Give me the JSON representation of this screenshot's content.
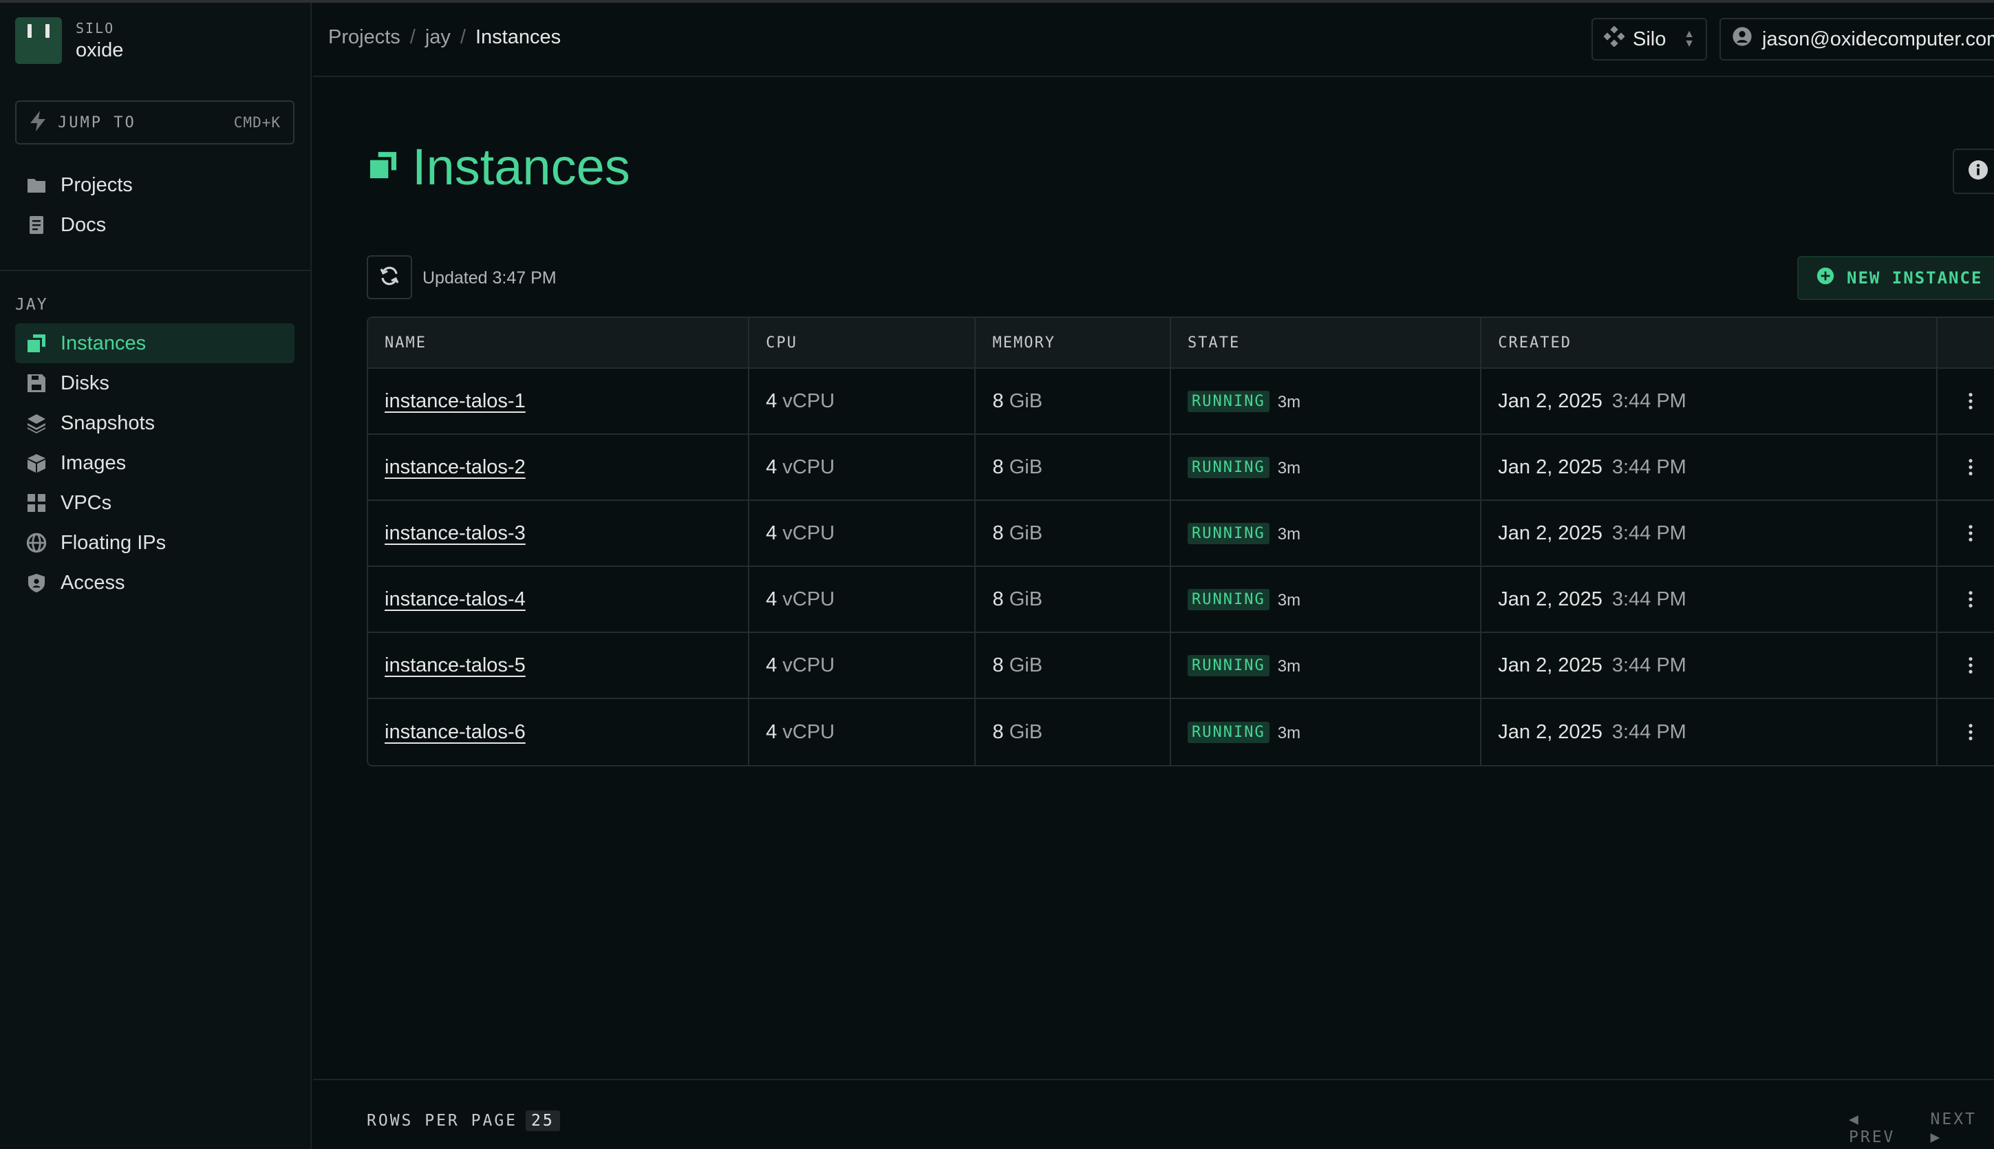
{
  "colors": {
    "accent": "#48d597",
    "background": "#080f11",
    "sidebar_bg": "#0a1214"
  },
  "sidebar": {
    "silo_label": "SILO",
    "silo_name": "oxide",
    "jump": {
      "label": "JUMP TO",
      "shortcut": "CMD+K"
    },
    "global_items": [
      {
        "label": "Projects",
        "icon": "folder-icon"
      },
      {
        "label": "Docs",
        "icon": "document-icon"
      }
    ],
    "section_label": "JAY",
    "project_items": [
      {
        "label": "Instances",
        "icon": "instances-icon",
        "active": true
      },
      {
        "label": "Disks",
        "icon": "disk-icon"
      },
      {
        "label": "Snapshots",
        "icon": "snapshots-icon"
      },
      {
        "label": "Images",
        "icon": "images-icon"
      },
      {
        "label": "VPCs",
        "icon": "vpc-icon"
      },
      {
        "label": "Floating IPs",
        "icon": "globe-icon"
      },
      {
        "label": "Access",
        "icon": "access-icon"
      }
    ]
  },
  "topbar": {
    "breadcrumbs": [
      "Projects",
      "jay",
      "Instances"
    ],
    "separator": "/",
    "silo_switch": "Silo",
    "user": "jason@oxidecomputer.com"
  },
  "main": {
    "title": "Instances",
    "updated": "Updated 3:47 PM",
    "new_button": "NEW INSTANCE"
  },
  "table": {
    "columns": [
      "NAME",
      "CPU",
      "MEMORY",
      "STATE",
      "CREATED"
    ],
    "rows": [
      {
        "name": "instance-talos-1",
        "cpu_n": "4",
        "cpu_unit": "vCPU",
        "mem_n": "8",
        "mem_unit": "GiB",
        "state": "RUNNING",
        "age": "3m",
        "date": "Jan 2, 2025",
        "time": "3:44 PM"
      },
      {
        "name": "instance-talos-2",
        "cpu_n": "4",
        "cpu_unit": "vCPU",
        "mem_n": "8",
        "mem_unit": "GiB",
        "state": "RUNNING",
        "age": "3m",
        "date": "Jan 2, 2025",
        "time": "3:44 PM"
      },
      {
        "name": "instance-talos-3",
        "cpu_n": "4",
        "cpu_unit": "vCPU",
        "mem_n": "8",
        "mem_unit": "GiB",
        "state": "RUNNING",
        "age": "3m",
        "date": "Jan 2, 2025",
        "time": "3:44 PM"
      },
      {
        "name": "instance-talos-4",
        "cpu_n": "4",
        "cpu_unit": "vCPU",
        "mem_n": "8",
        "mem_unit": "GiB",
        "state": "RUNNING",
        "age": "3m",
        "date": "Jan 2, 2025",
        "time": "3:44 PM"
      },
      {
        "name": "instance-talos-5",
        "cpu_n": "4",
        "cpu_unit": "vCPU",
        "mem_n": "8",
        "mem_unit": "GiB",
        "state": "RUNNING",
        "age": "3m",
        "date": "Jan 2, 2025",
        "time": "3:44 PM"
      },
      {
        "name": "instance-talos-6",
        "cpu_n": "4",
        "cpu_unit": "vCPU",
        "mem_n": "8",
        "mem_unit": "GiB",
        "state": "RUNNING",
        "age": "3m",
        "date": "Jan 2, 2025",
        "time": "3:44 PM"
      }
    ]
  },
  "footer": {
    "rows_per_page_label": "ROWS PER PAGE",
    "rows_per_page": "25",
    "prev": "PREV",
    "next": "NEXT"
  }
}
